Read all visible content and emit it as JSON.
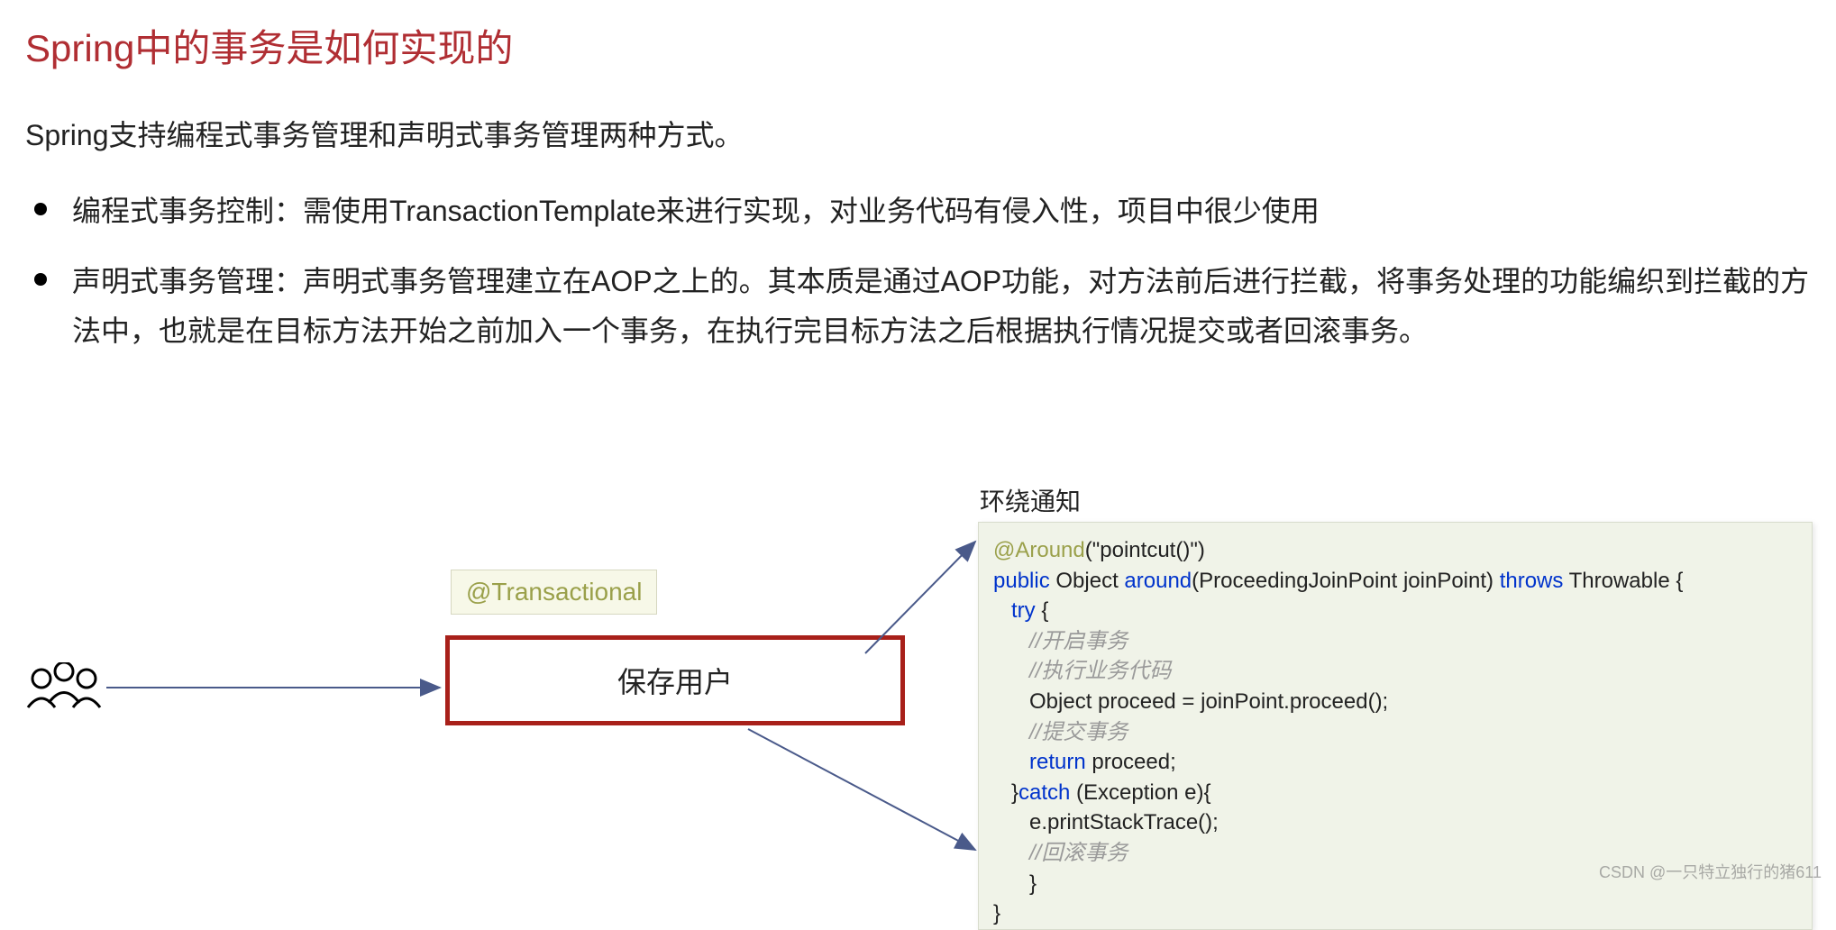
{
  "title": "Spring中的事务是如何实现的",
  "intro": "Spring支持编程式事务管理和声明式事务管理两种方式。",
  "bullets": [
    "编程式事务控制：需使用TransactionTemplate来进行实现，对业务代码有侵入性，项目中很少使用",
    "声明式事务管理：声明式事务管理建立在AOP之上的。其本质是通过AOP功能，对方法前后进行拦截，将事务处理的功能编织到拦截的方法中，也就是在目标方法开始之前加入一个事务，在执行完目标方法之后根据执行情况提交或者回滚事务。"
  ],
  "annotation": "@Transactional",
  "centerBox": "保存用户",
  "codeHeader": "环绕通知",
  "code": {
    "around": "@Around",
    "around_arg": "(\"pointcut()\")",
    "public": "public",
    "ret": " Object ",
    "method": "around",
    "params": "(ProceedingJoinPoint joinPoint) ",
    "throws": "throws",
    "throwable": " Throwable {",
    "try": "try",
    "try_brace": " {",
    "c1": "//开启事务",
    "c2": "//执行业务代码",
    "proceed": "Object proceed = joinPoint.proceed();",
    "c3": "//提交事务",
    "return": "return",
    "return_tail": " proceed;",
    "catch_open": "}",
    "catch": "catch",
    "catch_params": " (Exception e){",
    "print": "e.printStackTrace();",
    "c4": "//回滚事务",
    "brace_close": "}",
    "final_brace": "}"
  },
  "watermark": "CSDN @一只特立独行的猪611"
}
